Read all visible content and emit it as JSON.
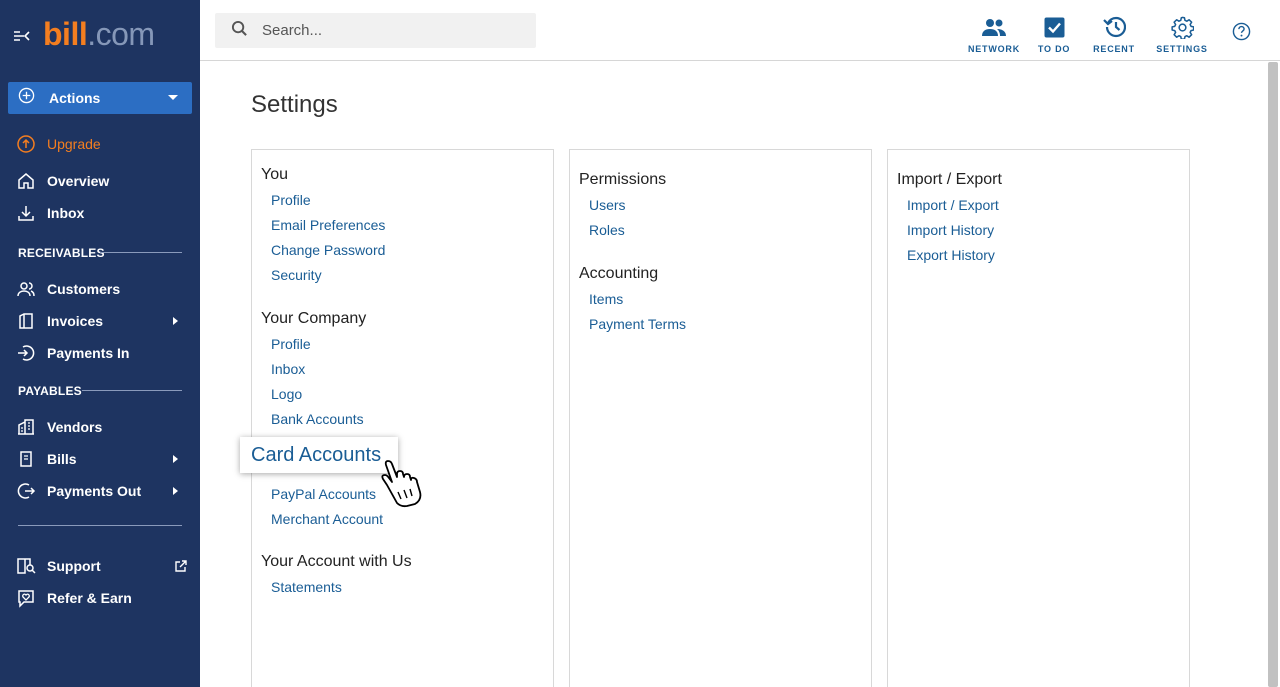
{
  "sidebar": {
    "logo_bold": "bill",
    "logo_rest": ".com",
    "actions_label": "Actions",
    "upgrade_label": "Upgrade",
    "overview_label": "Overview",
    "inbox_label": "Inbox",
    "receivables_heading": "RECEIVABLES",
    "customers_label": "Customers",
    "invoices_label": "Invoices",
    "payments_in_label": "Payments In",
    "payables_heading": "PAYABLES",
    "vendors_label": "Vendors",
    "bills_label": "Bills",
    "payments_out_label": "Payments Out",
    "support_label": "Support",
    "refer_label": "Refer & Earn"
  },
  "header": {
    "search_placeholder": "Search...",
    "network_label": "NETWORK",
    "todo_label": "TO DO",
    "recent_label": "RECENT",
    "settings_label": "SETTINGS"
  },
  "main": {
    "title": "Settings",
    "you": {
      "heading": "You",
      "profile": "Profile",
      "email_prefs": "Email Preferences",
      "change_password": "Change Password",
      "security": "Security"
    },
    "company": {
      "heading": "Your Company",
      "profile": "Profile",
      "inbox": "Inbox",
      "logo": "Logo",
      "bank_accounts": "Bank Accounts",
      "card_accounts": "Card Accounts",
      "paypal_accounts": "PayPal Accounts",
      "merchant_account": "Merchant Account"
    },
    "account": {
      "heading": "Your Account with Us",
      "statements": "Statements"
    },
    "permissions": {
      "heading": "Permissions",
      "users": "Users",
      "roles": "Roles"
    },
    "accounting": {
      "heading": "Accounting",
      "items": "Items",
      "payment_terms": "Payment Terms"
    },
    "import_export": {
      "heading": "Import / Export",
      "import_export": "Import / Export",
      "import_history": "Import History",
      "export_history": "Export History"
    }
  },
  "colors": {
    "sidebar_bg": "#1e3461",
    "accent_orange": "#f47e20",
    "link_blue": "#1a5d95",
    "actions_blue": "#2c6ec3"
  }
}
